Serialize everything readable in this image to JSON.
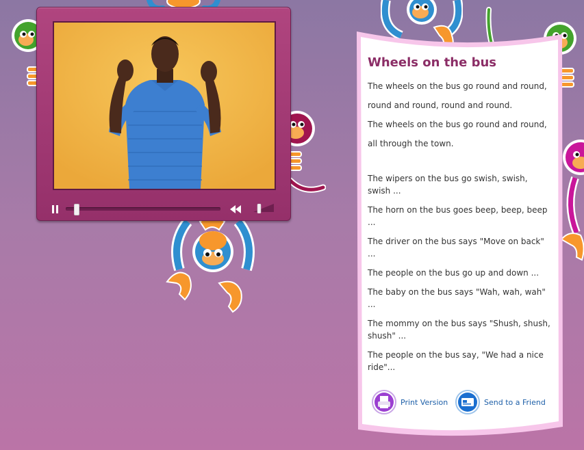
{
  "video": {
    "play_state": "playing"
  },
  "lyrics": {
    "title": "Wheels on the bus",
    "chorus": [
      "The wheels on the bus go round and round,",
      "round and round, round and round.",
      "The wheels on the bus go round and round,",
      "all through the town."
    ],
    "verses": [
      "The wipers on the bus go swish, swish, swish ...",
      "The horn on the bus goes beep, beep, beep ...",
      "The driver on the bus says \"Move on back\" ...",
      "The people on the bus go up and down ...",
      "The baby on the bus says \"Wah, wah, wah\" ...",
      "The mommy on the bus says \"Shush, shush, shush\" ...",
      "The people on the bus say, \"We had a nice ride\"..."
    ]
  },
  "actions": {
    "print_label": "Print Version",
    "send_label": "Send to a Friend"
  },
  "colors": {
    "title": "#8b2d66",
    "player": "#a13a73",
    "link": "#1d5fa8",
    "background_top": "#8c77a3",
    "background_bottom": "#bb74a7"
  }
}
